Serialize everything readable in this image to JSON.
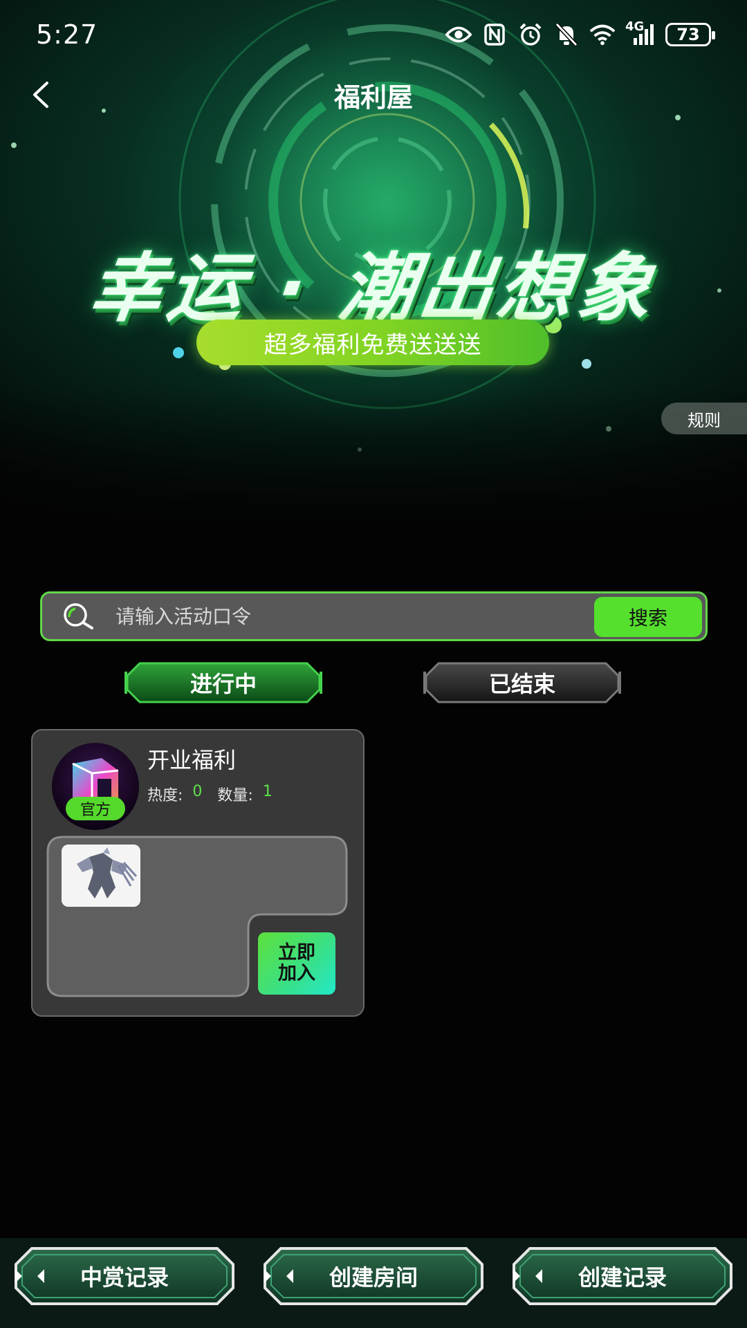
{
  "status_bar": {
    "time": "5:27",
    "network": "4G",
    "battery": "73"
  },
  "header": {
    "title": "福利屋"
  },
  "banner": {
    "headline": "幸运 · 潮出想象",
    "tagline": "超多福利免费送送送",
    "rules_label": "规则"
  },
  "search": {
    "placeholder": "请输入活动口令",
    "button_label": "搜索"
  },
  "tabs": [
    {
      "label": "进行中",
      "active": true
    },
    {
      "label": "已结束",
      "active": false
    }
  ],
  "activities": [
    {
      "title": "开业福利",
      "badge": "官方",
      "heat_label": "热度:",
      "heat_value": "0",
      "count_label": "数量:",
      "count_value": "1",
      "join_label_line1": "立即",
      "join_label_line2": "加入"
    }
  ],
  "bottom_nav": [
    {
      "label": "中赏记录"
    },
    {
      "label": "创建房间"
    },
    {
      "label": "创建记录"
    }
  ],
  "colors": {
    "accent_green": "#55e02e",
    "background": "#030303",
    "card_bg": "#383838"
  }
}
